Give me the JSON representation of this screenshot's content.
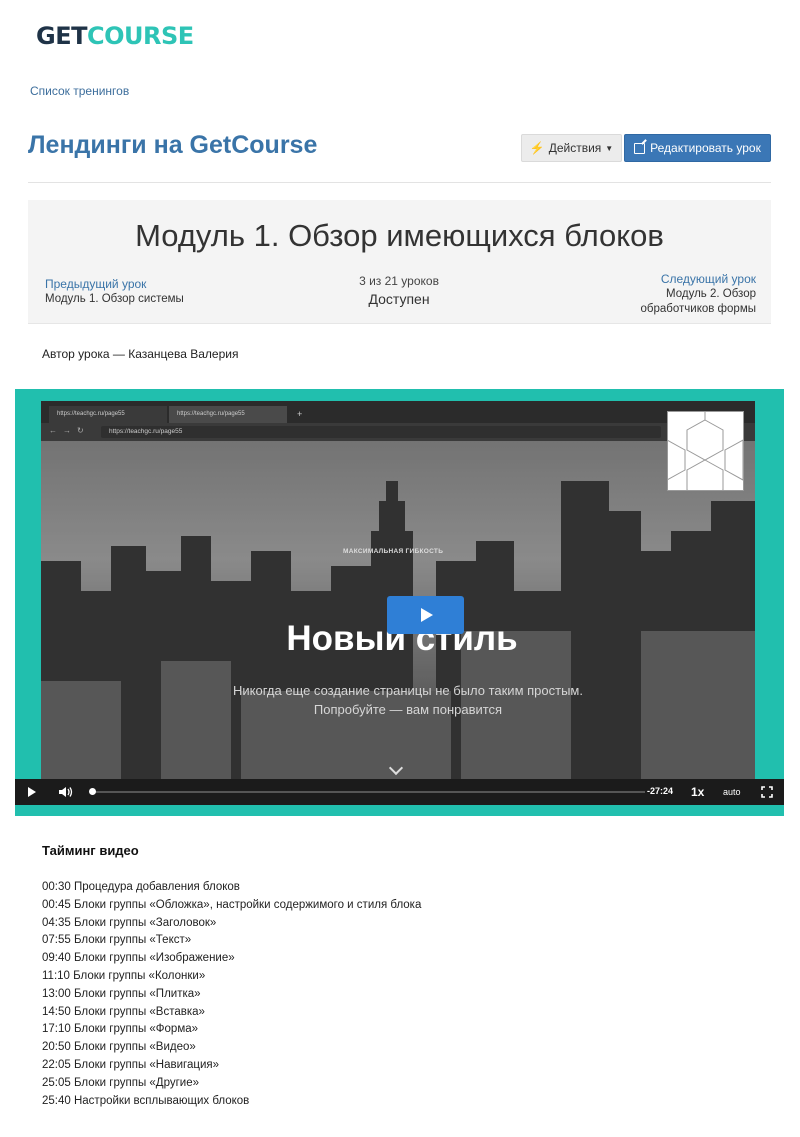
{
  "logo": {
    "part1": "GET",
    "part2": "COURSE"
  },
  "breadcrumb": "Список тренингов",
  "course_title": "Лендинги на GetCourse",
  "actions_label": "Действия",
  "edit_label": "Редактировать урок",
  "lesson": {
    "title": "Модуль 1. Обзор имеющихся блоков",
    "prev_label": "Предыдущий урок",
    "prev_value": "Модуль 1. Обзор системы",
    "count": "3 из 21 уроков",
    "status": "Доступен",
    "next_label": "Следующий урок",
    "next_value": "Модуль 2. Обзор обработчиков формы"
  },
  "author": "Автор урока — Казанцева Валерия",
  "video": {
    "tab1": "https://teachgc.ru/page55",
    "tab2": "https://teachgc.ru/page55",
    "url": "https://teachgc.ru/page55",
    "promo_small": "МАКСИМАЛЬНАЯ ГИБКОСТЬ",
    "headline": "Новый стиль",
    "subline1": "Никогда еще создание страницы не было таким простым.",
    "subline2": "Попробуйте — вам понравится",
    "time": "-27:24",
    "speed": "1x",
    "quality": "auto",
    "progress": 0.0,
    "accent_color": "#21bfae"
  },
  "timing": {
    "title": "Тайминг видео",
    "items": [
      "00:30 Процедура добавления блоков",
      "00:45 Блоки группы «Обложка», настройки содержимого и стиля блока",
      "04:35 Блоки группы «Заголовок»",
      "07:55 Блоки группы «Текст»",
      "09:40 Блоки группы «Изображение»",
      "11:10 Блоки группы «Колонки»",
      "13:00 Блоки группы «Плитка»",
      "14:50 Блоки группы «Вставка»",
      "17:10 Блоки группы «Форма»",
      "20:50 Блоки группы «Видео»",
      "22:05 Блоки группы «Навигация»",
      "25:05 Блоки группы «Другие»",
      "25:40 Настройки всплывающих блоков"
    ]
  }
}
